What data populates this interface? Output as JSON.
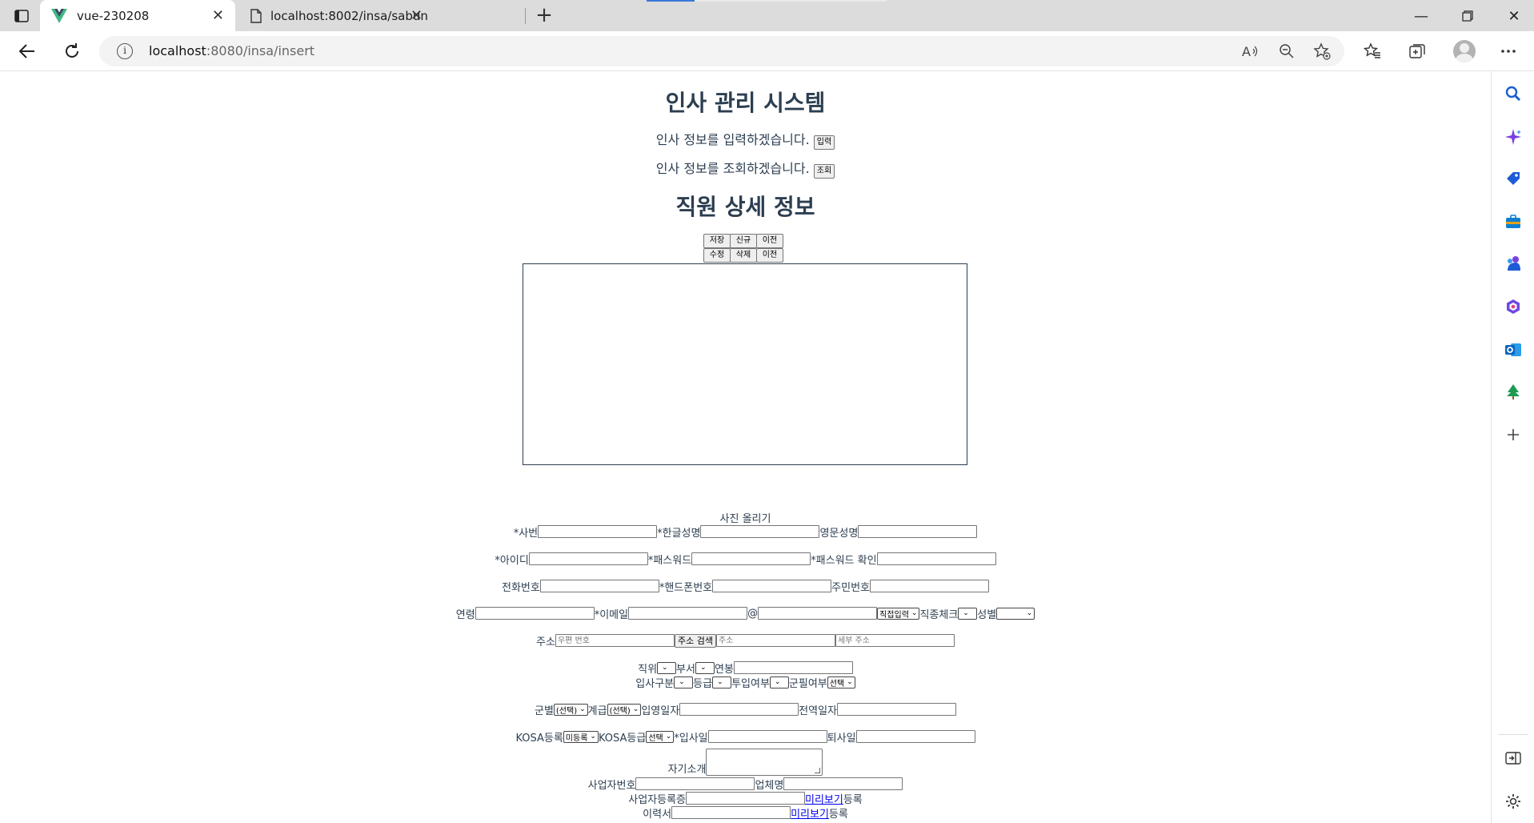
{
  "browser": {
    "tabs": [
      {
        "title": "vue-230208",
        "active": true
      },
      {
        "title": "localhost:8002/insa/sabun",
        "active": false
      }
    ],
    "url_host": "localhost",
    "url_rest": ":8080/insa/insert"
  },
  "page": {
    "title": "인사 관리 시스템",
    "input_line": "인사 정보를 입력하겠습니다.",
    "input_button": "입력",
    "search_line": "인사 정보를 조회하겠습니다.",
    "search_button": "조회",
    "detail_title": "직원 상세 정보",
    "buttons_row1": [
      "저장",
      "신규",
      "이전"
    ],
    "buttons_row2": [
      "수정",
      "삭제",
      "이전"
    ],
    "photo_label": "사진 올리기"
  },
  "form": {
    "sabun": "*사번",
    "name_kor": "*한글성명",
    "name_eng": "영문성명",
    "id": "*아이디",
    "pwd": "*패스워드",
    "pwd_confirm": "*패스워드 확인",
    "phone": "전화번호",
    "mobile": "*핸드폰번호",
    "jumin": "주민번호",
    "age": "연령",
    "email": "*이메일",
    "at": "@",
    "email_domain_select": "직접입력",
    "job_type": "직종체크",
    "gender": "성별",
    "address": "주소",
    "zip_placeholder": "우편 번호",
    "address_search_button": "주소 검색",
    "addr_placeholder": "주소",
    "addr_detail_placeholder": "세부 주소",
    "position": "직위",
    "dept": "부서",
    "salary": "연봉",
    "join_type": "입사구분",
    "grade": "등급",
    "deploy": "투입여부",
    "military": "군필여부",
    "military_select": "선택",
    "mil_branch": "군별",
    "mil_branch_select": "(선택)",
    "mil_rank": "계급",
    "mil_rank_select": "(선택)",
    "enlist_date": "입영일자",
    "discharge_date": "전역일자",
    "kosa_reg": "KOSA등록",
    "kosa_reg_select": "미등록",
    "kosa_grade": "KOSA등급",
    "kosa_grade_select": "선택",
    "join_date": "*입사일",
    "leave_date": "퇴사일",
    "self_intro": "자기소개",
    "biz_no": "사업자번호",
    "company": "업체명",
    "biz_cert": "사업자등록증",
    "resume": "이력서",
    "preview": "미리보기",
    "register": "등록"
  }
}
